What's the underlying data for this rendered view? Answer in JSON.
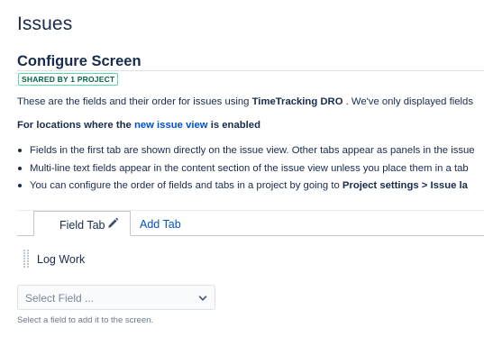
{
  "header": {
    "title": "Issues"
  },
  "screen": {
    "title": "Configure Screen",
    "badge": "SHARED BY 1 PROJECT"
  },
  "description": {
    "prefix": "These are the fields and their order for issues using ",
    "scheme": "TimeTracking DRO",
    "suffix": " . We've only displayed fields"
  },
  "locations": {
    "prefix": "For locations where the ",
    "link": "new issue view",
    "suffix": " is enabled"
  },
  "bullets": [
    {
      "text": "Fields in the first tab are shown directly on the issue view. Other tabs appear as panels in the issue"
    },
    {
      "text": "Multi-line text fields appear in the content section of the issue view unless you place them in a tab"
    },
    {
      "prefix": "You can configure the order of fields and tabs in a project by going to ",
      "bold": "Project settings > Issue la"
    }
  ],
  "tabs": {
    "active_label": "Field Tab",
    "add_label": "Add Tab"
  },
  "fields": [
    {
      "name": "Log Work"
    }
  ],
  "select_field": {
    "placeholder": "Select Field ...",
    "help": "Select a field to add it to the screen."
  },
  "colors": {
    "text": "#172b4d",
    "link": "#0052cc",
    "badge_border": "#57d9a3",
    "badge_text": "#006644",
    "muted": "#6b778c"
  },
  "icons": {
    "edit": "pencil-icon",
    "drag": "drag-handle-icon",
    "dropdown": "chevron-down-icon"
  }
}
